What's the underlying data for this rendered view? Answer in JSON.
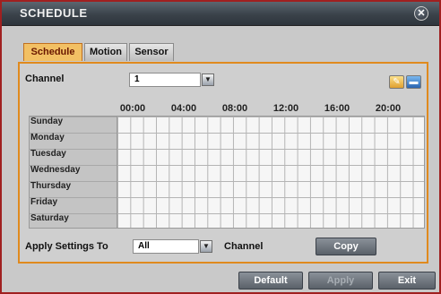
{
  "window": {
    "title": "SCHEDULE",
    "close_glyph": "✕"
  },
  "tabs": [
    {
      "label": "Schedule",
      "active": true
    },
    {
      "label": "Motion",
      "active": false
    },
    {
      "label": "Sensor",
      "active": false
    }
  ],
  "channel": {
    "label": "Channel",
    "value": "1"
  },
  "grid": {
    "hours": [
      "00:00",
      "04:00",
      "08:00",
      "12:00",
      "16:00",
      "20:00"
    ],
    "days": [
      "Sunday",
      "Monday",
      "Tuesday",
      "Wednesday",
      "Thursday",
      "Friday",
      "Saturday"
    ]
  },
  "apply": {
    "label": "Apply Settings To",
    "value": "All",
    "suffix": "Channel",
    "copy_label": "Copy"
  },
  "footer": {
    "default_label": "Default",
    "apply_label": "Apply",
    "exit_label": "Exit"
  },
  "colors": {
    "accent": "#e08a1e",
    "title_bar": "#3a424a",
    "frame": "#a02020"
  },
  "icons": {
    "close": "close-icon",
    "edit": "pencil-icon",
    "erase": "eraser-icon",
    "dropdown": "chevron-down-icon"
  }
}
